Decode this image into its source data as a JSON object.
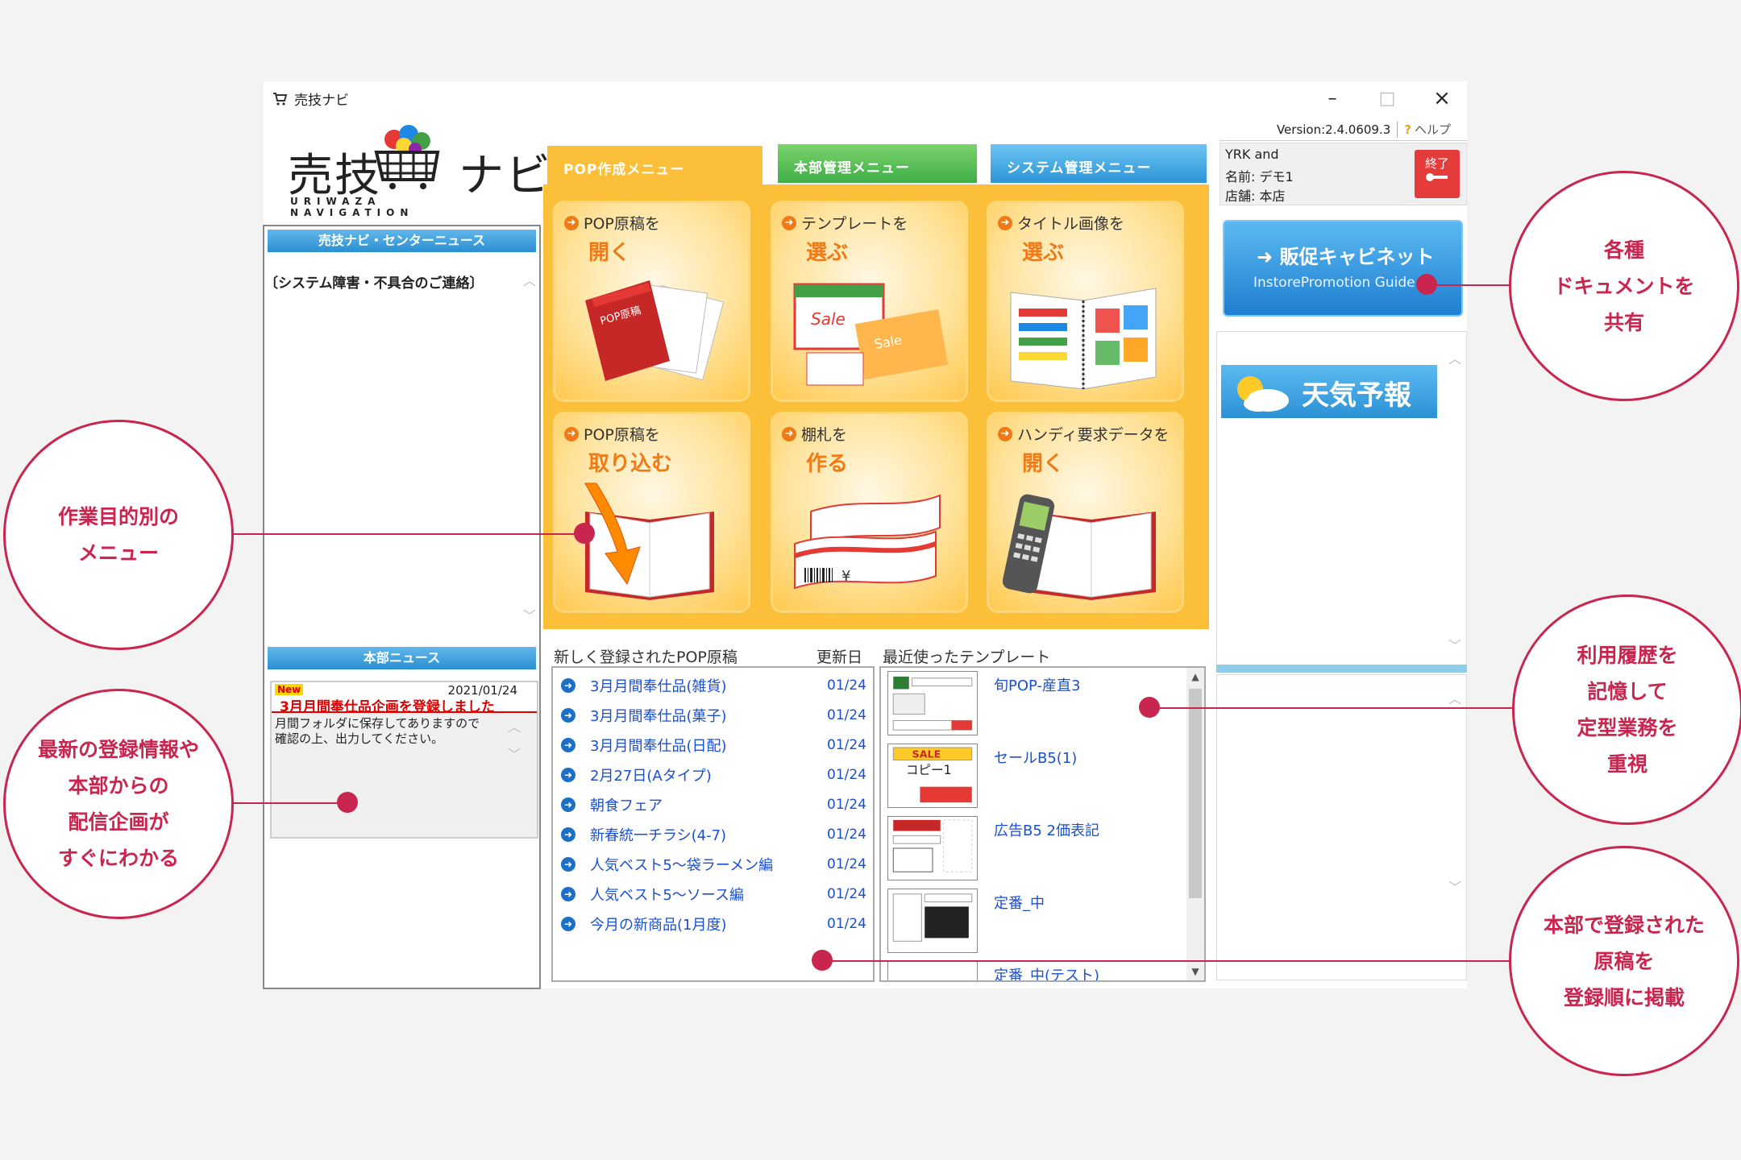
{
  "window": {
    "title": "売技ナビ",
    "controls": {
      "minimize": "–",
      "maximize": "□",
      "close": "×"
    }
  },
  "header": {
    "version": "Version:2.4.0609.3",
    "help_label": "ヘルプ",
    "help_icon": "?"
  },
  "logo": {
    "text": "売技ナビ",
    "subtitle": "URIWAZA NAVIGATION"
  },
  "center_news": {
    "title": "売技ナビ・センターニュース",
    "message": "〔システム障害・不具合のご連絡〕"
  },
  "hq_news": {
    "title": "本部ニュース",
    "badge": "New",
    "date": "2021/01/24",
    "headline": "3月月間奉仕品企画を登録しました",
    "body": [
      "月間フォルダに保存してありますので",
      "確認の上、出力してください。"
    ]
  },
  "tabs": [
    {
      "label": "POP作成メニュー"
    },
    {
      "label": "本部管理メニュー"
    },
    {
      "label": "システム管理メニュー"
    }
  ],
  "menu_tiles": [
    {
      "line1": "POP原稿を",
      "line2": "開く",
      "icon": "folder-icon"
    },
    {
      "line1": "テンプレートを",
      "line2": "選ぶ",
      "icon": "sale-card-icon"
    },
    {
      "line1": "タイトル画像を",
      "line2": "選ぶ",
      "icon": "catalog-icon"
    },
    {
      "line1": "POP原稿を",
      "line2": "取り込む",
      "icon": "import-icon"
    },
    {
      "line1": "棚札を",
      "line2": "作る",
      "icon": "shelf-tag-icon"
    },
    {
      "line1": "ハンディ要求データを",
      "line2": "開く",
      "icon": "handy-terminal-icon"
    }
  ],
  "new_pop": {
    "header": "新しく登録されたPOP原稿",
    "date_header": "更新日",
    "items": [
      {
        "name": "3月月間奉仕品(雑貨)",
        "date": "01/24"
      },
      {
        "name": "3月月間奉仕品(菓子)",
        "date": "01/24"
      },
      {
        "name": "3月月間奉仕品(日配)",
        "date": "01/24"
      },
      {
        "name": "2月27日(Aタイプ)",
        "date": "01/24"
      },
      {
        "name": "朝食フェア",
        "date": "01/24"
      },
      {
        "name": "新春統一チラシ(4-7)",
        "date": "01/24"
      },
      {
        "name": "人気ベスト5～袋ラーメン編",
        "date": "01/24"
      },
      {
        "name": "人気ベスト5～ソース編",
        "date": "01/24"
      },
      {
        "name": "今月の新商品(1月度)",
        "date": "01/24"
      }
    ]
  },
  "recent_templates": {
    "header": "最近使ったテンプレート",
    "items": [
      {
        "name": "旬POP-産直3"
      },
      {
        "name": "セールB5(1)"
      },
      {
        "name": "広告B5 2価表記"
      },
      {
        "name": "定番_中"
      },
      {
        "name": "定番_中(テスト)"
      }
    ]
  },
  "user": {
    "line1": "YRK and",
    "line2": "名前: デモ1",
    "line3": "店舗: 本店",
    "exit_label": "終了"
  },
  "cabinet": {
    "title": "販促キャビネット",
    "subtitle": "InstorePromotion Guide"
  },
  "weather": {
    "label": "天気予報"
  },
  "annotations": {
    "docs": [
      "各種",
      "ドキュメントを",
      "共有"
    ],
    "menu": [
      "作業目的別の",
      "メニュー"
    ],
    "history": [
      "利用履歴を",
      "記憶して",
      "定型業務を",
      "重視"
    ],
    "latest": [
      "最新の登録情報や",
      "本部からの",
      "配信企画が",
      "すぐにわかる"
    ],
    "order": [
      "本部で登録された",
      "原稿を",
      "登録順に掲載"
    ]
  },
  "colors": {
    "accent": "#c9264f",
    "menu_bg": "#fbbf3a",
    "tile_label": "#ef7a16",
    "link": "#1a4fd0"
  }
}
